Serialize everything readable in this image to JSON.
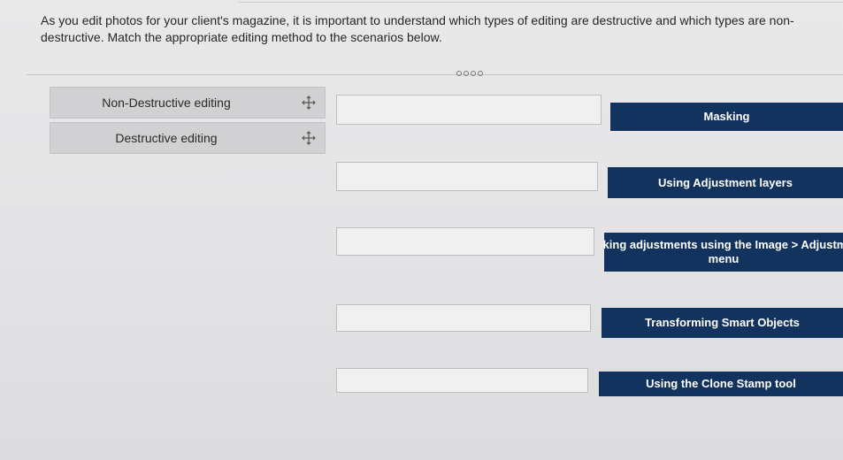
{
  "question": {
    "text": "As you edit photos for your client's magazine, it is important to understand which types of editing are destructive and which types are non-destructive. Match the appropriate editing method to the scenarios below."
  },
  "pager": {
    "dots": 4
  },
  "drag_options": [
    {
      "label": "Non-Destructive editing",
      "icon": "move-icon"
    },
    {
      "label": "Destructive editing",
      "icon": "move-icon"
    }
  ],
  "targets": [
    {
      "line1": "Masking",
      "line2": ""
    },
    {
      "line1": "Using Adjustment layers",
      "line2": ""
    },
    {
      "line1": "Making adjustments using the Image > Adjustmen",
      "line2": "menu"
    },
    {
      "line1": "Transforming Smart Objects",
      "line2": ""
    },
    {
      "line1": "Using the Clone Stamp tool",
      "line2": ""
    }
  ],
  "colors": {
    "target_bg": "#13335f",
    "tile_bg": "#d1d1d3"
  }
}
